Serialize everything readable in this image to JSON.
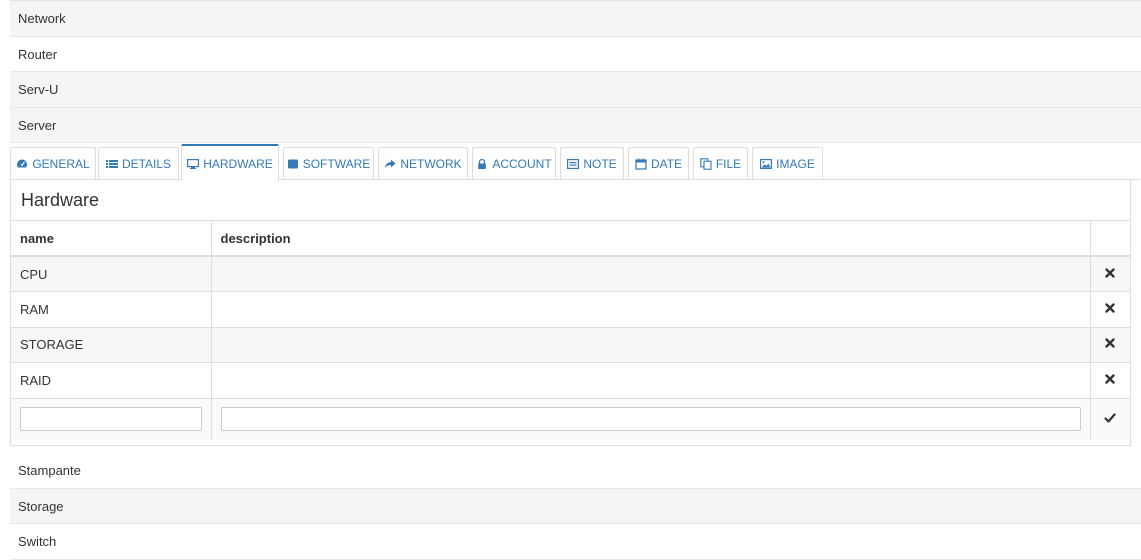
{
  "categories_top": [
    {
      "label": "Network"
    },
    {
      "label": "Router"
    },
    {
      "label": "Serv-U"
    },
    {
      "label": "Server"
    }
  ],
  "tabs": [
    {
      "label": "GENERAL",
      "icon": "tachometer-icon"
    },
    {
      "label": "DETAILS",
      "icon": "list-icon"
    },
    {
      "label": "HARDWARE",
      "icon": "desktop-icon",
      "active": true
    },
    {
      "label": "SOFTWARE",
      "icon": "stop-icon"
    },
    {
      "label": "NETWORK",
      "icon": "share-icon"
    },
    {
      "label": "ACCOUNT",
      "icon": "lock-icon"
    },
    {
      "label": "NOTE",
      "icon": "list-alt-icon"
    },
    {
      "label": "DATE",
      "icon": "calendar-icon"
    },
    {
      "label": "FILE",
      "icon": "copy-icon"
    },
    {
      "label": "IMAGE",
      "icon": "image-icon"
    }
  ],
  "panel": {
    "title": "Hardware",
    "columns": {
      "name": "name",
      "description": "description"
    },
    "rows": [
      {
        "name": "CPU",
        "description": ""
      },
      {
        "name": "RAM",
        "description": ""
      },
      {
        "name": "STORAGE",
        "description": ""
      },
      {
        "name": "RAID",
        "description": ""
      }
    ],
    "new_row": {
      "name_value": "",
      "description_value": ""
    }
  },
  "categories_bottom": [
    {
      "label": "Stampante"
    },
    {
      "label": "Storage"
    },
    {
      "label": "Switch"
    }
  ],
  "colors": {
    "accent": "#337ab7",
    "border": "#dddddd",
    "stripe": "#f5f5f5"
  }
}
